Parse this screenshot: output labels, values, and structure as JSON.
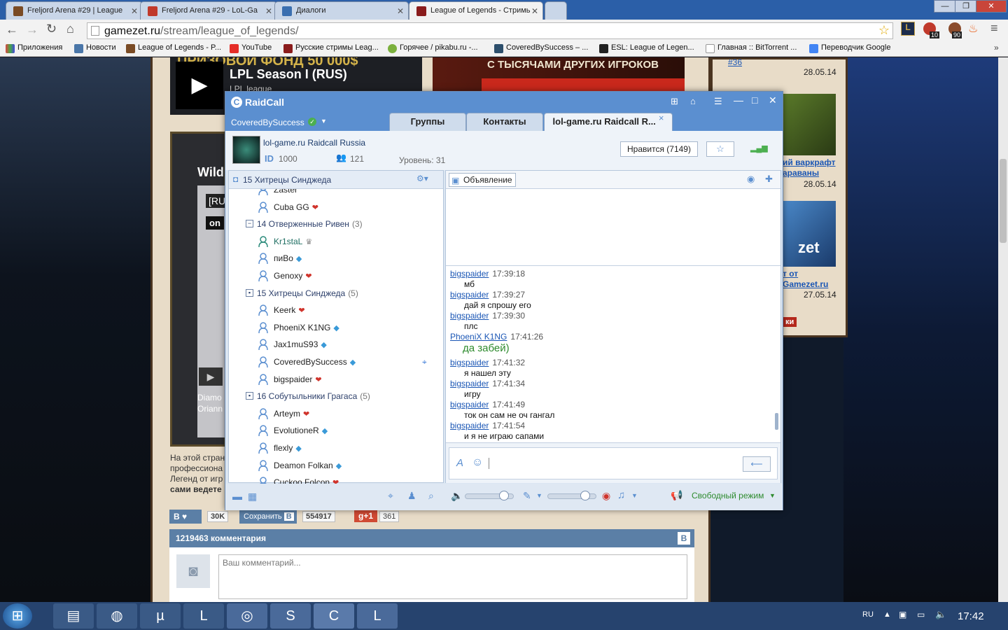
{
  "browser": {
    "tabs": [
      {
        "title": "Freljord Arena #29 | League"
      },
      {
        "title": "Freljord Arena #29 - LoL-Ga"
      },
      {
        "title": "Диалоги"
      },
      {
        "title": "League of Legends - Стримь"
      }
    ],
    "url_host": "gamezet.ru",
    "url_path": "/stream/league_of_legends/",
    "ext_badges": {
      "red": "10",
      "pet": "90"
    },
    "bookmarks": [
      "Приложения",
      "Новости",
      "League of Legends - P...",
      "YouTube",
      "Русские стримы Leag...",
      "Горячее / pikabu.ru -...",
      "CoveredBySuccess – ...",
      "ESL: League of Legen...",
      "Главная :: BitTorrent ...",
      "Переводчик Google"
    ]
  },
  "page": {
    "banner_prize": "ПРИЗОВОЙ ФОНД 50 000$",
    "banner_others": "С ТЫСЯЧАМИ ДРУГИХ ИГРОКОВ",
    "stream_title": "LPL Season I (RUS)",
    "stream_sub": "LPL league",
    "wild": "Wild",
    "ru_tag": "[RU",
    "on_tag": "on",
    "diamond": "Diamo",
    "orianna": "Oriann",
    "desc_lines": [
      "На этой стран",
      "профессиона",
      "Легенд от игр",
      "сами ведете"
    ],
    "side_top": "#36",
    "side_date1": "28.05.14",
    "side_link2a": "ий варкрафт",
    "side_link2b": "араваны",
    "side_date2": "28.05.14",
    "side_link3a": "т от",
    "side_link3b": "Gamezet.ru",
    "side_date3": "27.05.14",
    "side_tag": "ки",
    "zet_logo": "zet",
    "share": {
      "vk": "В",
      "likes": "30K",
      "save": "Сохранить",
      "save_icon": "В",
      "save_count": "554917",
      "gplus": "g+1",
      "gplus_count": "361"
    },
    "comments_title": "1219463 комментария",
    "comment_placeholder": "Ваш комментарий..."
  },
  "raidcall": {
    "app_name": "RaidCall",
    "user": "CoveredBySuccess",
    "tabs": [
      "Группы",
      "Контакты",
      "lol-game.ru Raidcall R..."
    ],
    "channel_name": "lol-game.ru Raidcall Russia",
    "id_label": "ID",
    "id_value": "1000",
    "members_count": "121",
    "level": "Уровень: 31",
    "like_button": "Нравится (7149)",
    "current_channel": "15 Хитрецы Синджеда",
    "announce": "Объявление",
    "tree": [
      {
        "kind": "member",
        "name": "Zaster",
        "cut": true
      },
      {
        "kind": "member",
        "name": "Cuba GG",
        "badge": "heart"
      },
      {
        "kind": "group",
        "name": "14 Отверженные Ривен",
        "count": "(3)",
        "box": "−"
      },
      {
        "kind": "member",
        "name": "Kr1staL",
        "badge": "crown",
        "teal": true
      },
      {
        "kind": "member",
        "name": "пиВо",
        "badge": "diamond"
      },
      {
        "kind": "member",
        "name": "Genoxy",
        "badge": "heart"
      },
      {
        "kind": "group",
        "name": "15 Хитрецы Синджеда",
        "count": "(5)",
        "box": "▪"
      },
      {
        "kind": "member",
        "name": "Keerk",
        "badge": "heart"
      },
      {
        "kind": "member",
        "name": "PhoeniX K1NG",
        "badge": "diamond"
      },
      {
        "kind": "member",
        "name": "Jax1muS93",
        "badge": "diamond"
      },
      {
        "kind": "member",
        "name": "CoveredBySuccess",
        "badge": "diamond",
        "pin": true
      },
      {
        "kind": "member",
        "name": "bigspaider",
        "badge": "heart"
      },
      {
        "kind": "group",
        "name": "16 Собутыльники Грагаса",
        "count": "(5)",
        "box": "▪"
      },
      {
        "kind": "member",
        "name": "Arteym",
        "badge": "heart"
      },
      {
        "kind": "member",
        "name": "EvolutioneR",
        "badge": "diamond"
      },
      {
        "kind": "member",
        "name": "flexly",
        "badge": "diamond"
      },
      {
        "kind": "member",
        "name": "Deamon Folkan",
        "badge": "diamond"
      },
      {
        "kind": "member",
        "name": "Cuckoo Folcon",
        "badge": "heart",
        "cut": true
      }
    ],
    "chat": [
      {
        "user": "bigspaider",
        "time": "17:39:18",
        "text": "мб"
      },
      {
        "user": "bigspaider",
        "time": "17:39:27",
        "text": "дай я спрошу его"
      },
      {
        "user": "bigspaider",
        "time": "17:39:30",
        "text": "плс"
      },
      {
        "user": "PhoeniX K1NG",
        "time": "17:41:26",
        "text": "да забей)",
        "big": true
      },
      {
        "user": "bigspaider",
        "time": "17:41:32",
        "text": "я нашел эту"
      },
      {
        "user": "bigspaider",
        "time": "17:41:34",
        "text": "игру"
      },
      {
        "user": "bigspaider",
        "time": "17:41:49",
        "text": "ток он сам не оч гангал"
      },
      {
        "user": "bigspaider",
        "time": "17:41:54",
        "text": "и я не играю сапами"
      }
    ],
    "free_mode": "Свободный режим",
    "volume_level": 0.85,
    "mic_level": 0.82,
    "colors": {
      "title_bar": "#5b8fd0",
      "link": "#1a56b5",
      "phoenix": "#1a56b5",
      "green_msg": "#2e8b2e"
    }
  },
  "taskbar": {
    "lang": "RU",
    "time": "17:42"
  }
}
